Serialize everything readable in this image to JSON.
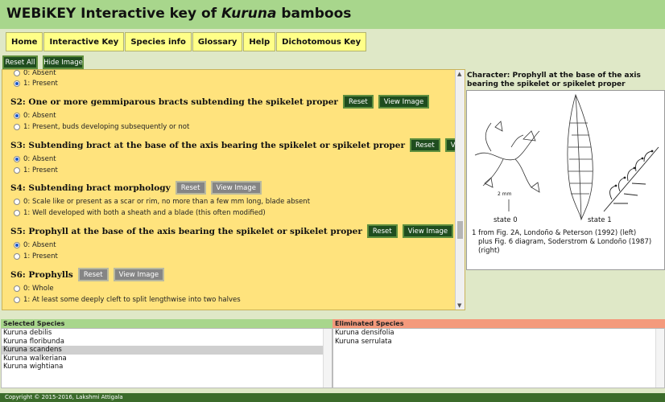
{
  "header": {
    "title_prefix": "WEBiKEY Interactive key of ",
    "title_italic": "Kuruna",
    "title_suffix": " bamboos"
  },
  "nav": [
    "Home",
    "Interactive Key",
    "Species info",
    "Glossary",
    "Help",
    "Dichotomous Key"
  ],
  "toolbar": {
    "reset_all": "Reset All",
    "hide_image": "Hide Image"
  },
  "prev_options": [
    "0: Absent",
    "1: Present"
  ],
  "characters": [
    {
      "title": "S2: One or more gemmiparous bracts subtending the spikelet proper",
      "reset": "Reset",
      "view": "View Image",
      "options": [
        "0: Absent",
        "1: Present, buds developing subsequently or not"
      ]
    },
    {
      "title": "S3: Subtending bract at the base of the axis bearing the spikelet or spikelet proper",
      "reset": "Reset",
      "view": "View Image",
      "options": [
        "0: Absent",
        "1: Present"
      ]
    },
    {
      "title": "S4: Subtending bract morphology",
      "reset": "Reset",
      "view": "View Image",
      "options": [
        "0: Scale like or present as a scar or rim, no more than a few mm long, blade absent",
        "1: Well developed with both a sheath and a blade (this often modified)"
      ]
    },
    {
      "title": "S5: Prophyll at the base of the axis bearing the spikelet or spikelet proper",
      "reset": "Reset",
      "view": "View Image",
      "options": [
        "0: Absent",
        "1: Present"
      ]
    },
    {
      "title": "S6: Prophylls",
      "reset": "Reset",
      "view": "View Image",
      "options": [
        "0: Whole",
        "1: At least some deeply cleft to split lengthwise into two halves"
      ]
    }
  ],
  "character_panel": {
    "title": "Character: Prophyll at the base of the axis bearing the spikelet or spikelet proper",
    "state0": "state 0",
    "state1": "state 1",
    "scale": "2 mm",
    "caption_line1": "1 from Fig. 2A, Londoño & Peterson (1992) (left)",
    "caption_line2": "plus Fig. 6 diagram, Soderstrom & Londoño (1987) (right)"
  },
  "selected": {
    "header": "Selected Species",
    "items": [
      "Kuruna debilis",
      "Kuruna floribunda",
      "Kuruna scandens",
      "Kuruna walkeriana",
      "Kuruna wightiana"
    ],
    "highlighted": "Kuruna scandens"
  },
  "eliminated": {
    "header": "Eliminated Species",
    "items": [
      "Kuruna densifolia",
      "Kuruna serrulata"
    ]
  },
  "footer": "Copyright © 2015-2016, Lakshmi Attigala",
  "colors": {
    "header": "#a8d68c",
    "panel": "#ffe37d",
    "button": "#1f4d1f",
    "selected_header": "#a8d68c",
    "eliminated_header": "#f49a7c"
  }
}
